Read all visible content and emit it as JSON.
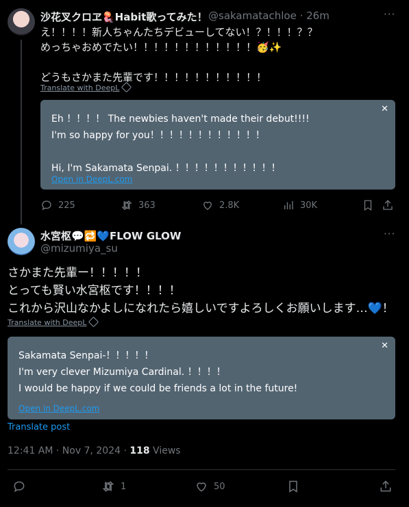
{
  "post1": {
    "display_name": "沙花叉クロヱ🪼Habit歌ってみた！",
    "handle_time": "@sakamatachloe · 26m",
    "body": "え！！！！新人ちゃんたちデビューしてない！？！！！？？\nめっちゃおめでたい！！！！！！！！！！！！🥳✨\n\nどうもさかまた先輩です！！！！！！！！！！！",
    "translate_link": "Translate with DeepL",
    "translation": {
      "text": "Eh ！！！！ The newbies haven't made their debut!!!!\nI'm so happy for you！！！！！！！！！！！！\n\nHi, I'm Sakamata Senpai. ！！！！！！！！！！！",
      "open_link": "Open in DeepL.com",
      "close_label": "✕"
    },
    "stats": {
      "replies": "225",
      "reposts": "363",
      "likes": "2.8K",
      "views": "30K"
    },
    "more_label": "···"
  },
  "post2": {
    "display_name": "水宮枢💬🔁💙FLOW GLOW",
    "handle": "@mizumiya_su",
    "body": "さかまた先輩ー！！！！！\nとっても賢い水宮枢です！！！！\nこれから沢山なかよしになれたら嬉しいですよろしくお願いします…💙！",
    "translate_link": "Translate with DeepL",
    "translation": {
      "text": "Sakamata Senpai-！！！！！\nI'm very clever Mizumiya Cardinal. ！！！！\nI would be happy if we could be friends a lot in the future!",
      "open_link": "Open in DeepL.com",
      "close_label": "✕"
    },
    "translate_post": "Translate post",
    "timestamp": "12:41 AM · Nov 7, 2024 · ",
    "views_count": "118",
    "views_label": " Views",
    "stats": {
      "reposts": "1",
      "likes": "50"
    },
    "more_label": "···"
  },
  "icons": [
    "reply-icon",
    "repost-icon",
    "like-icon",
    "views-icon",
    "bookmark-icon",
    "share-icon",
    "deepl-icon",
    "close-icon"
  ]
}
